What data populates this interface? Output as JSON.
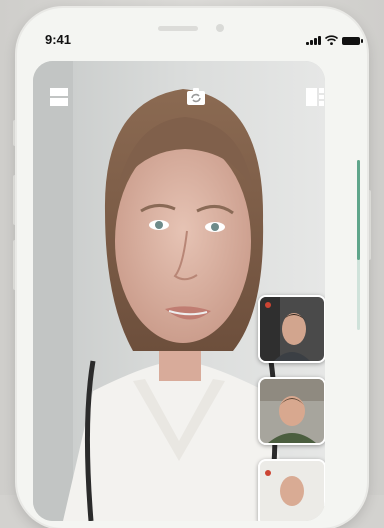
{
  "status_bar": {
    "time": "9:41"
  },
  "icons": {
    "top_left": "layout-rows-icon",
    "top_center": "switch-camera-icon",
    "top_right": "layout-side-icon",
    "signal": "cellular-signal-icon",
    "wifi": "wifi-icon",
    "battery": "battery-icon"
  },
  "call": {
    "main_participant": "doctor-video-feed",
    "participants": [
      "participant-1",
      "participant-2",
      "participant-3"
    ]
  },
  "colors": {
    "accent": "#5fa58b",
    "frame": "#f4f5f2"
  }
}
